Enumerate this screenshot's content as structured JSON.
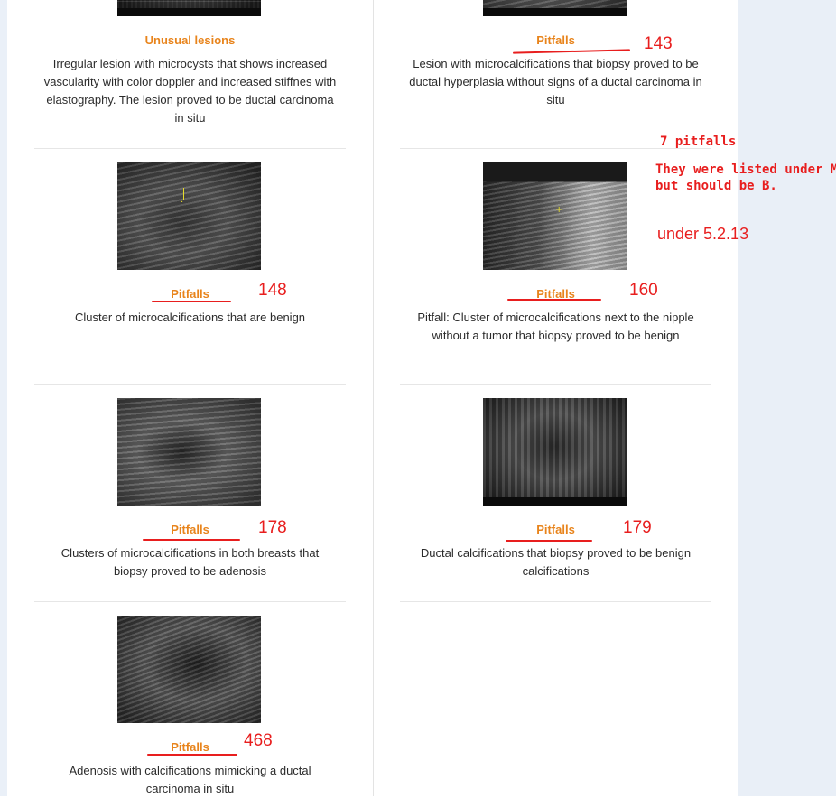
{
  "cards": [
    {
      "category": "Unusual lesions",
      "description": "Irregular lesion with microcysts that shows increased vascularity with color doppler and increased stiffnes with elastography. The lesion proved to be ductal carcinoma in situ",
      "annotation": ""
    },
    {
      "category": "Pitfalls",
      "description": "Lesion with microcalcifications that biopsy proved to be ductal hyperplasia without signs of a ductal carcinoma in situ",
      "annotation": "143"
    },
    {
      "category": "Pitfalls",
      "description": "Cluster of microcalcifications that are benign",
      "annotation": "148"
    },
    {
      "category": "Pitfalls",
      "description": "Pitfall: Cluster of microcalcifications next to the nipple without a tumor that biopsy proved to be benign",
      "annotation": "160"
    },
    {
      "category": "Pitfalls",
      "description": "Clusters of microcalcifications in both breasts that biopsy proved to be adenosis",
      "annotation": "178"
    },
    {
      "category": "Pitfalls",
      "description": "Ductal calcifications that biopsy proved to be benign calcifications",
      "annotation": "179"
    },
    {
      "category": "Pitfalls",
      "description": "Adenosis with calcifications mimicking a ductal carcinoma in situ",
      "annotation": "468"
    }
  ],
  "notes": {
    "count": "7 pitfalls",
    "line1": "They were listed under M,",
    "line2": "but should be B.",
    "section": "under 5.2.13"
  },
  "colors": {
    "category": "#e8841c",
    "annotation": "#e81e1e",
    "sidebar": "#e9eff7"
  }
}
